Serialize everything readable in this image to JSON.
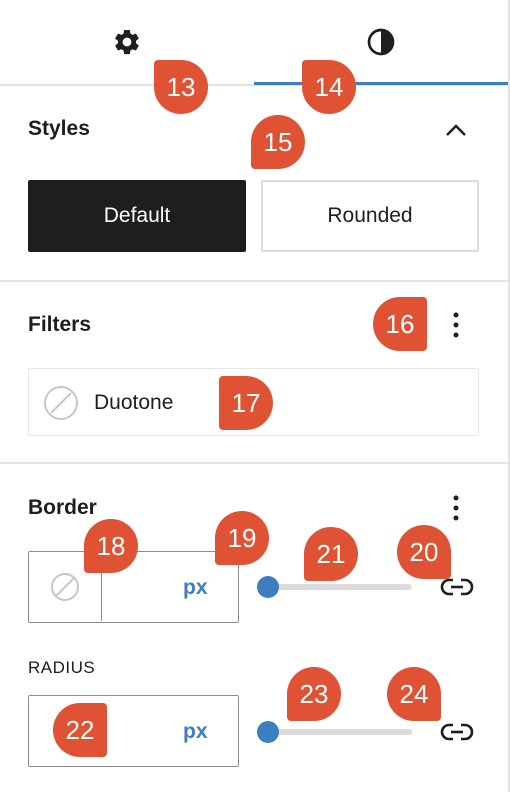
{
  "tabs": [
    {
      "name": "settings",
      "icon": "gear-icon"
    },
    {
      "name": "styles",
      "icon": "contrast-icon",
      "active": true
    }
  ],
  "styles_panel": {
    "title": "Styles",
    "options": [
      {
        "label": "Default",
        "selected": true
      },
      {
        "label": "Rounded",
        "selected": false
      }
    ]
  },
  "filters_panel": {
    "title": "Filters",
    "duotone_label": "Duotone"
  },
  "border_panel": {
    "title": "Border",
    "width_unit": "px",
    "radius_label": "RADIUS",
    "radius_unit": "px",
    "width_slider_value": 0,
    "radius_slider_value": 0
  },
  "badges": [
    "13",
    "14",
    "15",
    "16",
    "17",
    "18",
    "19",
    "20",
    "21",
    "22",
    "23",
    "24"
  ],
  "colors": {
    "accent": "#3c7ec0",
    "badge": "#df5233",
    "dark_button": "#1e1e1e"
  }
}
